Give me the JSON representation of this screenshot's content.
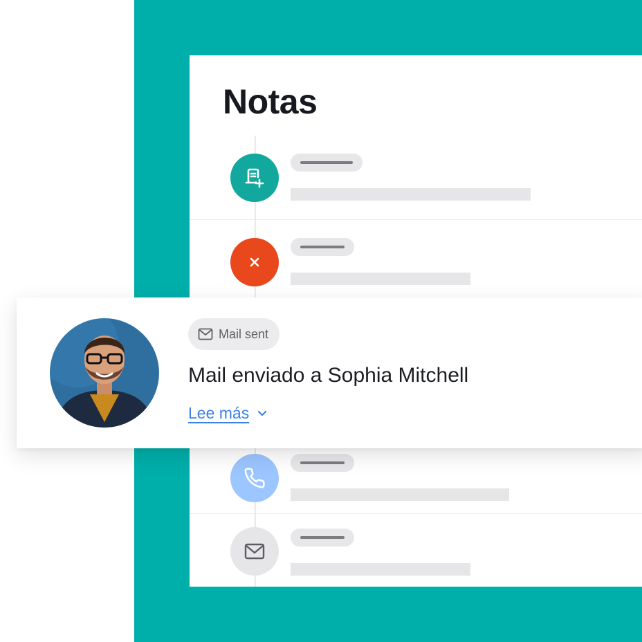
{
  "notes_panel": {
    "title": "Notas",
    "timeline": [
      {
        "icon": "document-add-icon",
        "color": "#13A89E"
      },
      {
        "icon": "close-icon",
        "color": "#E8481C"
      },
      {
        "icon": "phone-icon",
        "color": "#9CC6FF"
      },
      {
        "icon": "mail-icon",
        "color": "#E6E6E8"
      }
    ]
  },
  "activity_card": {
    "badge": {
      "icon": "mail-icon",
      "label": "Mail sent"
    },
    "title": "Mail enviado a Sophia Mitchell",
    "read_more": {
      "label": "Lee más",
      "icon": "chevron-down-icon"
    }
  },
  "colors": {
    "brand_teal": "#00AFAA",
    "link": "#3A80E8"
  }
}
